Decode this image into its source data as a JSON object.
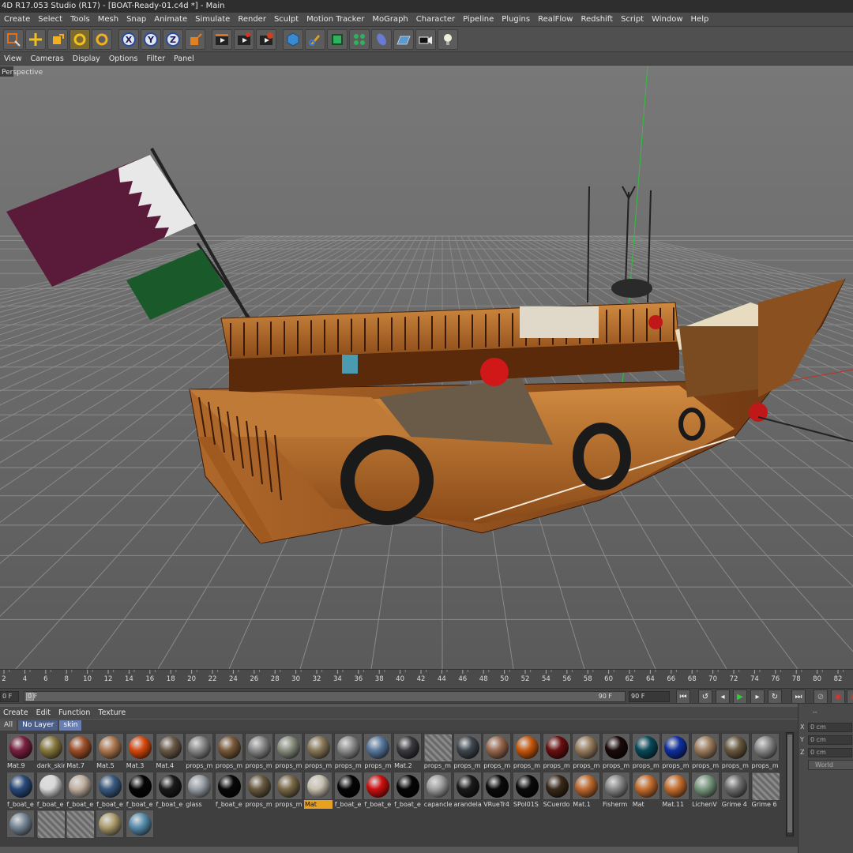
{
  "window": {
    "title": "4D R17.053 Studio (R17) - [BOAT-Ready-01.c4d *] - Main"
  },
  "menu": [
    "Create",
    "Select",
    "Tools",
    "Mesh",
    "Snap",
    "Animate",
    "Simulate",
    "Render",
    "Sculpt",
    "Motion Tracker",
    "MoGraph",
    "Character",
    "Pipeline",
    "Plugins",
    "RealFlow",
    "Redshift",
    "Script",
    "Window",
    "Help"
  ],
  "toolbar_icons": [
    "live-selection-icon",
    "move-icon",
    "scale-icon",
    "rotate-icon",
    "rotate-alt-icon",
    "x-axis-icon",
    "y-axis-icon",
    "z-axis-icon",
    "coordinate-system-icon",
    "render-region-icon",
    "render-view-icon",
    "render-settings-icon",
    "cube-icon",
    "pen-icon",
    "subdivision-icon",
    "cloner-icon",
    "deformer-icon",
    "floor-icon",
    "camera-icon",
    "light-icon"
  ],
  "axis_labels": {
    "x": "X",
    "y": "Y",
    "z": "Z"
  },
  "viewport": {
    "menu": [
      "View",
      "Cameras",
      "Display",
      "Options",
      "Filter",
      "Panel"
    ],
    "label": "Perspective"
  },
  "timeline": {
    "ticks": [
      "2",
      "4",
      "6",
      "8",
      "10",
      "12",
      "14",
      "16",
      "18",
      "20",
      "22",
      "24",
      "26",
      "28",
      "30",
      "32",
      "34",
      "36",
      "38",
      "40",
      "42",
      "44",
      "46",
      "48",
      "50",
      "52",
      "54",
      "56",
      "58",
      "60",
      "62",
      "64",
      "66",
      "68",
      "70",
      "72",
      "74",
      "76",
      "78",
      "80",
      "82"
    ],
    "start_field": "0 F",
    "slider_left": "0 F",
    "slider_right": "90 F",
    "end_field": "90 F"
  },
  "material_manager": {
    "menu": [
      "Create",
      "Edit",
      "Function",
      "Texture"
    ],
    "layers": [
      "All",
      "No Layer",
      "skin"
    ],
    "rows": [
      [
        {
          "n": "Mat.9",
          "c": "#7a2040"
        },
        {
          "n": "dark_skin",
          "c": "#8a7a40"
        },
        {
          "n": "Mat.7",
          "c": "#a0502a"
        },
        {
          "n": "Mat.5",
          "c": "#b07a50"
        },
        {
          "n": "Mat.3",
          "c": "#d84a10"
        },
        {
          "n": "Mat.4",
          "c": "#6a5a48"
        },
        {
          "n": "props_m",
          "c": "#8a8a8a"
        },
        {
          "n": "props_m",
          "c": "#7a5a3a"
        },
        {
          "n": "props_m",
          "c": "#8c8c8c"
        },
        {
          "n": "props_m",
          "c": "#8a9080"
        },
        {
          "n": "props_m",
          "c": "#8a7a5a"
        },
        {
          "n": "props_m",
          "c": "#909090"
        },
        {
          "n": "props_m",
          "c": "#5a7aa0"
        },
        {
          "n": "Mat.2",
          "c": "#3a3a40"
        },
        {
          "n": "props_m",
          "c": "hatch"
        },
        {
          "n": "props_m",
          "c": "#404850"
        },
        {
          "n": "props_m",
          "c": "#9a6a50"
        },
        {
          "n": "props_m",
          "c": "#c85a10"
        },
        {
          "n": "props_m",
          "c": "#6a1010"
        },
        {
          "n": "props_m",
          "c": "#9a8060"
        },
        {
          "n": "props_m",
          "c": "#1a0a0a"
        },
        {
          "n": "props_m",
          "c": "#0a4a5a"
        },
        {
          "n": "props_m",
          "c": "#1030a0"
        },
        {
          "n": "props_m",
          "c": "#a08060"
        },
        {
          "n": "props_m",
          "c": "#6a5a40"
        },
        {
          "n": "props_m",
          "c": "#8a8a8a"
        }
      ],
      [
        {
          "n": "f_boat_e",
          "c": "#2a4a7a"
        },
        {
          "n": "f_boat_e",
          "c": "#d8d8d8"
        },
        {
          "n": "f_boat_e",
          "c": "#c0b0a0"
        },
        {
          "n": "f_boat_e",
          "c": "#3a5a80"
        },
        {
          "n": "f_boat_e",
          "c": "#050505"
        },
        {
          "n": "f_boat_e",
          "c": "#1a1a1a"
        },
        {
          "n": "glass",
          "c": "#9aa0a8"
        },
        {
          "n": "f_boat_e",
          "c": "#080808"
        },
        {
          "n": "props_m",
          "c": "#6a5a40"
        },
        {
          "n": "props_m",
          "c": "#7a6a48"
        },
        {
          "n": "Mat",
          "c": "#c8c0b0",
          "hl": true
        },
        {
          "n": "f_boat_e",
          "c": "#050505"
        },
        {
          "n": "f_boat_e",
          "c": "#d01010"
        },
        {
          "n": "f_boat_e",
          "c": "#050505"
        },
        {
          "n": "capancle",
          "c": "#a0a0a0"
        },
        {
          "n": "arandela",
          "c": "#1a1a1a"
        },
        {
          "n": "VRueTr4",
          "c": "#0a0a0a"
        },
        {
          "n": "SPol01S",
          "c": "#0a0a0a"
        },
        {
          "n": "SCuerdo",
          "c": "#3a2a1a"
        },
        {
          "n": "Mat.1",
          "c": "#c06a30"
        },
        {
          "n": "Fisherm",
          "c": "#8a8a8a"
        },
        {
          "n": "Mat",
          "c": "#c87030"
        },
        {
          "n": "Mat.11",
          "c": "#c87030"
        },
        {
          "n": "LichenV",
          "c": "#7a9a80"
        },
        {
          "n": "Grime 4",
          "c": "#707070"
        },
        {
          "n": "Grime 6",
          "c": "hatch"
        }
      ],
      [
        {
          "n": "",
          "c": "#7a8a9a"
        },
        {
          "n": "",
          "c": "hatch"
        },
        {
          "n": "",
          "c": "hatch"
        },
        {
          "n": "",
          "c": "#b0a070"
        },
        {
          "n": "",
          "c": "#5a90b0"
        }
      ]
    ]
  },
  "attributes": {
    "header": "--",
    "fields": [
      {
        "axis": "X",
        "value": "0 cm"
      },
      {
        "axis": "Y",
        "value": "0 cm"
      },
      {
        "axis": "Z",
        "value": "0 cm"
      }
    ],
    "coord_mode": "World"
  }
}
